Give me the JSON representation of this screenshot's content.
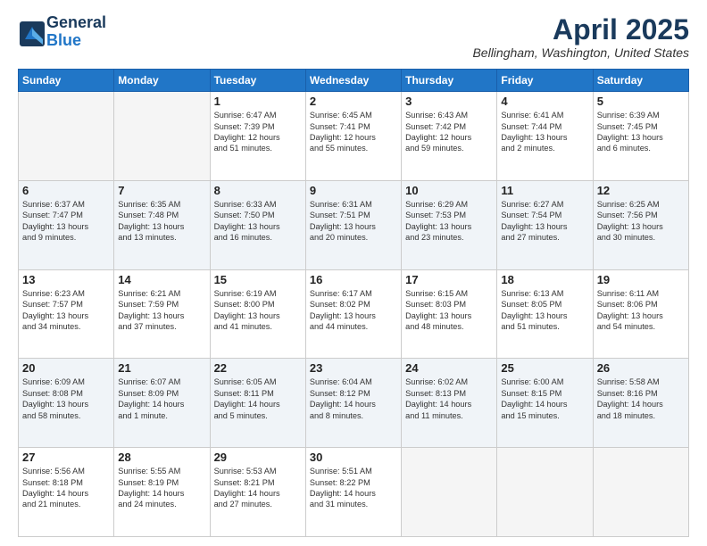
{
  "header": {
    "logo_general": "General",
    "logo_blue": "Blue",
    "title": "April 2025",
    "location": "Bellingham, Washington, United States"
  },
  "days_of_week": [
    "Sunday",
    "Monday",
    "Tuesday",
    "Wednesday",
    "Thursday",
    "Friday",
    "Saturday"
  ],
  "weeks": [
    [
      {
        "day": "",
        "info": "",
        "empty": true
      },
      {
        "day": "",
        "info": "",
        "empty": true
      },
      {
        "day": "1",
        "info": "Sunrise: 6:47 AM\nSunset: 7:39 PM\nDaylight: 12 hours\nand 51 minutes."
      },
      {
        "day": "2",
        "info": "Sunrise: 6:45 AM\nSunset: 7:41 PM\nDaylight: 12 hours\nand 55 minutes."
      },
      {
        "day": "3",
        "info": "Sunrise: 6:43 AM\nSunset: 7:42 PM\nDaylight: 12 hours\nand 59 minutes."
      },
      {
        "day": "4",
        "info": "Sunrise: 6:41 AM\nSunset: 7:44 PM\nDaylight: 13 hours\nand 2 minutes."
      },
      {
        "day": "5",
        "info": "Sunrise: 6:39 AM\nSunset: 7:45 PM\nDaylight: 13 hours\nand 6 minutes."
      }
    ],
    [
      {
        "day": "6",
        "info": "Sunrise: 6:37 AM\nSunset: 7:47 PM\nDaylight: 13 hours\nand 9 minutes."
      },
      {
        "day": "7",
        "info": "Sunrise: 6:35 AM\nSunset: 7:48 PM\nDaylight: 13 hours\nand 13 minutes."
      },
      {
        "day": "8",
        "info": "Sunrise: 6:33 AM\nSunset: 7:50 PM\nDaylight: 13 hours\nand 16 minutes."
      },
      {
        "day": "9",
        "info": "Sunrise: 6:31 AM\nSunset: 7:51 PM\nDaylight: 13 hours\nand 20 minutes."
      },
      {
        "day": "10",
        "info": "Sunrise: 6:29 AM\nSunset: 7:53 PM\nDaylight: 13 hours\nand 23 minutes."
      },
      {
        "day": "11",
        "info": "Sunrise: 6:27 AM\nSunset: 7:54 PM\nDaylight: 13 hours\nand 27 minutes."
      },
      {
        "day": "12",
        "info": "Sunrise: 6:25 AM\nSunset: 7:56 PM\nDaylight: 13 hours\nand 30 minutes."
      }
    ],
    [
      {
        "day": "13",
        "info": "Sunrise: 6:23 AM\nSunset: 7:57 PM\nDaylight: 13 hours\nand 34 minutes."
      },
      {
        "day": "14",
        "info": "Sunrise: 6:21 AM\nSunset: 7:59 PM\nDaylight: 13 hours\nand 37 minutes."
      },
      {
        "day": "15",
        "info": "Sunrise: 6:19 AM\nSunset: 8:00 PM\nDaylight: 13 hours\nand 41 minutes."
      },
      {
        "day": "16",
        "info": "Sunrise: 6:17 AM\nSunset: 8:02 PM\nDaylight: 13 hours\nand 44 minutes."
      },
      {
        "day": "17",
        "info": "Sunrise: 6:15 AM\nSunset: 8:03 PM\nDaylight: 13 hours\nand 48 minutes."
      },
      {
        "day": "18",
        "info": "Sunrise: 6:13 AM\nSunset: 8:05 PM\nDaylight: 13 hours\nand 51 minutes."
      },
      {
        "day": "19",
        "info": "Sunrise: 6:11 AM\nSunset: 8:06 PM\nDaylight: 13 hours\nand 54 minutes."
      }
    ],
    [
      {
        "day": "20",
        "info": "Sunrise: 6:09 AM\nSunset: 8:08 PM\nDaylight: 13 hours\nand 58 minutes."
      },
      {
        "day": "21",
        "info": "Sunrise: 6:07 AM\nSunset: 8:09 PM\nDaylight: 14 hours\nand 1 minute."
      },
      {
        "day": "22",
        "info": "Sunrise: 6:05 AM\nSunset: 8:11 PM\nDaylight: 14 hours\nand 5 minutes."
      },
      {
        "day": "23",
        "info": "Sunrise: 6:04 AM\nSunset: 8:12 PM\nDaylight: 14 hours\nand 8 minutes."
      },
      {
        "day": "24",
        "info": "Sunrise: 6:02 AM\nSunset: 8:13 PM\nDaylight: 14 hours\nand 11 minutes."
      },
      {
        "day": "25",
        "info": "Sunrise: 6:00 AM\nSunset: 8:15 PM\nDaylight: 14 hours\nand 15 minutes."
      },
      {
        "day": "26",
        "info": "Sunrise: 5:58 AM\nSunset: 8:16 PM\nDaylight: 14 hours\nand 18 minutes."
      }
    ],
    [
      {
        "day": "27",
        "info": "Sunrise: 5:56 AM\nSunset: 8:18 PM\nDaylight: 14 hours\nand 21 minutes."
      },
      {
        "day": "28",
        "info": "Sunrise: 5:55 AM\nSunset: 8:19 PM\nDaylight: 14 hours\nand 24 minutes."
      },
      {
        "day": "29",
        "info": "Sunrise: 5:53 AM\nSunset: 8:21 PM\nDaylight: 14 hours\nand 27 minutes."
      },
      {
        "day": "30",
        "info": "Sunrise: 5:51 AM\nSunset: 8:22 PM\nDaylight: 14 hours\nand 31 minutes."
      },
      {
        "day": "",
        "info": "",
        "empty": true
      },
      {
        "day": "",
        "info": "",
        "empty": true
      },
      {
        "day": "",
        "info": "",
        "empty": true
      }
    ]
  ]
}
